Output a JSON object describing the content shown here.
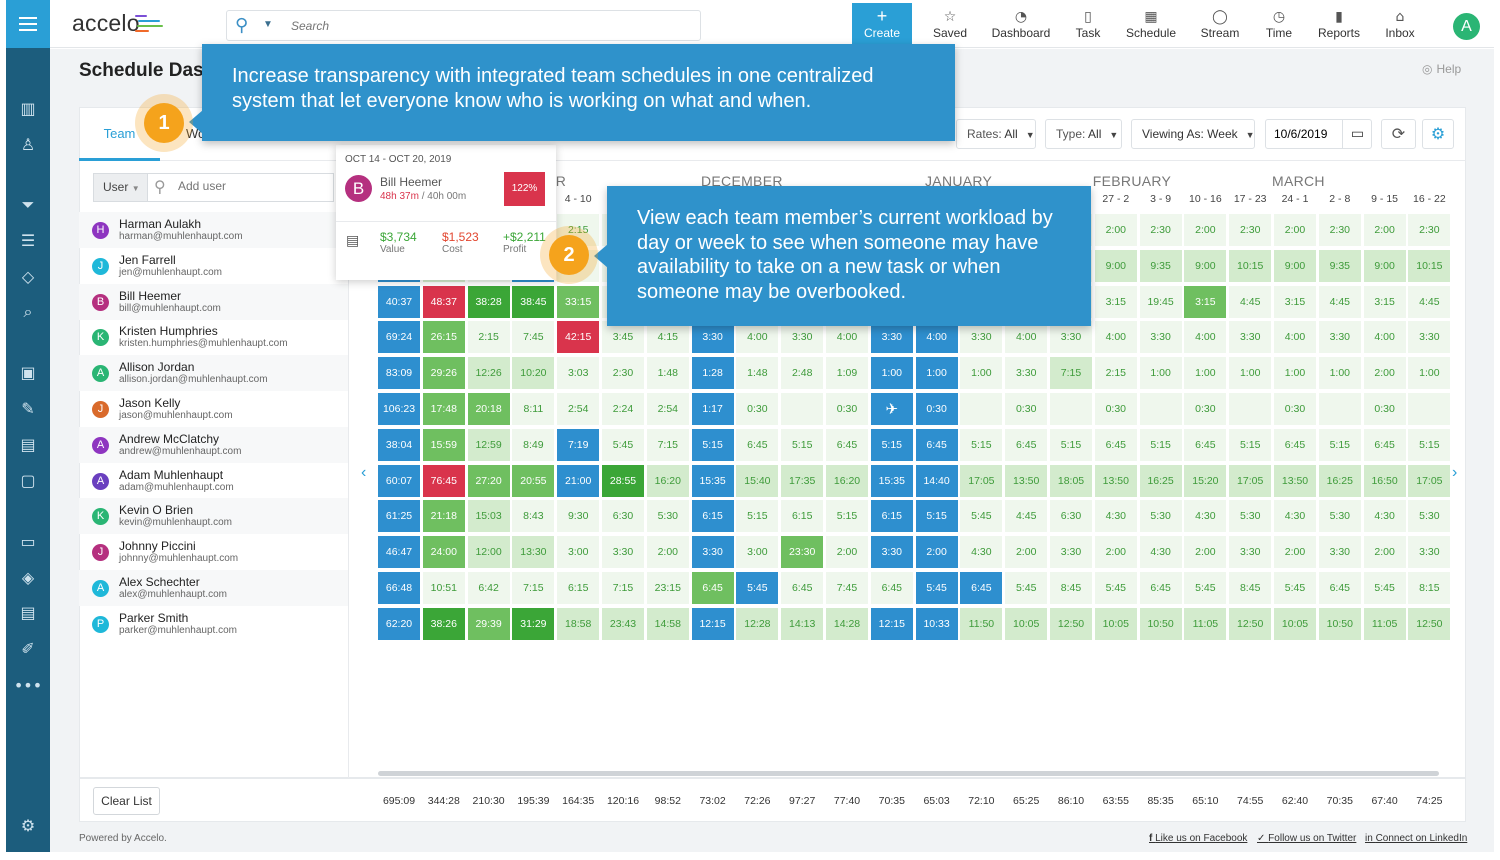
{
  "app": {
    "logo_text": "accelo",
    "title": "Schedule Dashboard",
    "help": "Help"
  },
  "search": {
    "placeholder": "Search"
  },
  "nav": {
    "create": "Create",
    "items": [
      {
        "label": "Saved",
        "icon": "star-icon"
      },
      {
        "label": "Dashboard",
        "icon": "dashboard-icon"
      },
      {
        "label": "Task",
        "icon": "clipboard-icon"
      },
      {
        "label": "Schedule",
        "icon": "calendar-icon"
      },
      {
        "label": "Stream",
        "icon": "chat-icon"
      },
      {
        "label": "Time",
        "icon": "clock-icon"
      },
      {
        "label": "Reports",
        "icon": "bar-chart-icon"
      },
      {
        "label": "Inbox",
        "icon": "inbox-icon"
      }
    ],
    "avatar": "A"
  },
  "sidebar_icons": [
    "building-icon",
    "user-icon",
    "funnel-icon",
    "hierarchy-icon",
    "tag-icon",
    "search-document-icon",
    "ticket-icon",
    "signature-icon",
    "invoice-icon",
    "clipboard-check-icon",
    "inbox-tray-icon",
    "box-icon",
    "document-dollar-icon",
    "edit-icon",
    "more-icon",
    "settings-icon"
  ],
  "tabs": {
    "team": "Team",
    "work": "Wo"
  },
  "toolbar": {
    "rates_label": "Rates:",
    "rates_value": "All",
    "type_label": "Type:",
    "type_value": "All",
    "viewing_label": "Viewing As:",
    "viewing_value": "Week",
    "date": "10/6/2019"
  },
  "user_filter": {
    "dropdown": "User",
    "placeholder": "Add user"
  },
  "colors": {
    "accent": "#2a9fd6",
    "over": "#d9344c",
    "under": "#2e8fcf",
    "booked": "#3ba637",
    "callout": "#2f92cb",
    "badge": "#f5a31c"
  },
  "level_legend": {
    "b": "under-booked (blue)",
    "r": "over-booked (red)",
    "G": "dark green",
    "M": "medium green",
    "L": "light green",
    "p": "pale green"
  },
  "months": [
    {
      "label": "NOVEMBER",
      "col": 2
    },
    {
      "label": "DECEMBER",
      "col": 7
    },
    {
      "label": "JANUARY",
      "col": 12
    },
    {
      "label": "FEBRUARY",
      "col": 16
    },
    {
      "label": "MARCH",
      "col": 20
    }
  ],
  "weeks": [
    "",
    "",
    "",
    "",
    "4 - 10",
    "",
    "",
    "",
    "",
    "",
    "",
    "",
    "",
    "",
    "",
    "",
    "27 - 2",
    "3 - 9",
    "10 - 16",
    "17 - 23",
    "24 - 1",
    "2 - 8",
    "9 - 15",
    "16 - 22"
  ],
  "users": [
    {
      "initial": "H",
      "color": "#8e35c0",
      "name": "Harman Aulakh",
      "email": "harman@muhlenhaupt.com",
      "levels": "pppppppppppppppppppppppp",
      "hours": [
        "",
        "",
        "",
        "",
        "2:15",
        "",
        "",
        "",
        "",
        "",
        "",
        "",
        "",
        "",
        "",
        "",
        "2:00",
        "2:30",
        "2:00",
        "2:30",
        "2:00",
        "2:30",
        "2:00",
        "2:30"
      ]
    },
    {
      "initial": "J",
      "color": "#1fb8d9",
      "name": "Jen Farrell",
      "email": "jen@muhlenhaupt.com",
      "levels": "bLpbppppppppppppLLLLLLLL",
      "hours": [
        "",
        "",
        "",
        "",
        "",
        "",
        "",
        "",
        "",
        "",
        "",
        "",
        "",
        "",
        "",
        "",
        "9:00",
        "9:35",
        "9:00",
        "10:15",
        "9:00",
        "9:35",
        "9:00",
        "10:15"
      ]
    },
    {
      "initial": "B",
      "color": "#b5307f",
      "name": "Bill Heemer",
      "email": "bill@muhlenhaupt.com",
      "levels": "brGGMpppppppppppppMppppppp",
      "hours": [
        "40:37",
        "48:37",
        "38:28",
        "38:45",
        "33:15",
        "",
        "",
        "",
        "",
        "",
        "",
        "",
        "",
        "",
        "",
        "",
        "3:15",
        "19:45",
        "3:15",
        "4:45",
        "3:15",
        "4:45",
        "3:15",
        "4:45"
      ]
    },
    {
      "initial": "K",
      "color": "#2ab574",
      "name": "Kristen Humphries",
      "email": "kristen.humphries@muhlenhaupt.com",
      "levels": "bMpprppbpppbbppppppppppp",
      "hours": [
        "69:24",
        "26:15",
        "2:15",
        "7:45",
        "42:15",
        "3:45",
        "4:15",
        "3:30",
        "4:00",
        "3:30",
        "4:00",
        "3:30",
        "4:00",
        "3:30",
        "4:00",
        "3:30",
        "4:00",
        "3:30",
        "4:00",
        "3:30",
        "4:00",
        "3:30",
        "4:00",
        "3:30"
      ]
    },
    {
      "initial": "A",
      "color": "#2ab574",
      "name": "Allison Jordan",
      "email": "allison.jordan@muhlenhaupt.com",
      "levels": "bMLLpppbpppbbppLpppppppp",
      "hours": [
        "83:09",
        "29:26",
        "12:26",
        "10:20",
        "3:03",
        "2:30",
        "1:48",
        "1:28",
        "1:48",
        "2:48",
        "1:09",
        "1:00",
        "1:00",
        "1:00",
        "3:30",
        "7:15",
        "2:15",
        "1:00",
        "1:00",
        "1:00",
        "1:00",
        "1:00",
        "2:00",
        "1:00"
      ]
    },
    {
      "initial": "J",
      "color": "#d96a2b",
      "name": "Jason Kelly",
      "email": "jason@muhlenhaupt.com",
      "levels": "bMMppppbpppbbppppppppppp",
      "icons": {
        "11": "airplane-icon"
      },
      "hours": [
        "106:23",
        "17:48",
        "20:18",
        "8:11",
        "2:54",
        "2:24",
        "2:54",
        "1:17",
        "0:30",
        "",
        "0:30",
        "",
        "0:30",
        "",
        "0:30",
        "",
        "0:30",
        "",
        "0:30",
        "",
        "0:30",
        "",
        "0:30",
        ""
      ]
    },
    {
      "initial": "A",
      "color": "#8e35c0",
      "name": "Andrew McClatchy",
      "email": "andrew@muhlenhaupt.com",
      "levels": "bMLpbppbpppbbppppppppppp",
      "hours": [
        "38:04",
        "15:59",
        "12:59",
        "8:49",
        "7:19",
        "5:45",
        "7:15",
        "5:15",
        "6:45",
        "5:15",
        "6:45",
        "5:15",
        "6:45",
        "5:15",
        "6:45",
        "5:15",
        "6:45",
        "5:15",
        "6:45",
        "5:15",
        "6:45",
        "5:15",
        "6:45",
        "5:15"
      ]
    },
    {
      "initial": "A",
      "color": "#6a3fbf",
      "name": "Adam Muhlenhaupt",
      "email": "adam@muhlenhaupt.com",
      "levels": "brMMbGLbLLLbbLLLLLLLLLLL",
      "hours": [
        "60:07",
        "76:45",
        "27:20",
        "20:55",
        "21:00",
        "28:55",
        "16:20",
        "15:35",
        "15:40",
        "17:35",
        "16:20",
        "15:35",
        "14:40",
        "17:05",
        "13:50",
        "18:05",
        "13:50",
        "16:25",
        "15:20",
        "17:05",
        "13:50",
        "16:25",
        "16:50",
        "17:05"
      ]
    },
    {
      "initial": "K",
      "color": "#2ab574",
      "name": "Kevin O Brien",
      "email": "kevin@muhlenhaupt.com",
      "levels": "bMLppppbpppbbppppppppppp",
      "hours": [
        "61:25",
        "21:18",
        "15:03",
        "8:43",
        "9:30",
        "6:30",
        "5:30",
        "6:15",
        "5:15",
        "6:15",
        "5:15",
        "6:15",
        "5:15",
        "5:45",
        "4:45",
        "6:30",
        "4:30",
        "5:30",
        "4:30",
        "5:30",
        "4:30",
        "5:30",
        "4:30",
        "5:30"
      ]
    },
    {
      "initial": "J",
      "color": "#b5307f",
      "name": "Johnny Piccini",
      "email": "johnny@muhlenhaupt.com",
      "levels": "bMLLpppbpMpbbppppppppppp",
      "hours": [
        "46:47",
        "24:00",
        "12:00",
        "13:30",
        "3:00",
        "3:30",
        "2:00",
        "3:30",
        "3:00",
        "23:30",
        "2:00",
        "3:30",
        "2:00",
        "4:30",
        "2:00",
        "3:30",
        "2:00",
        "4:30",
        "2:00",
        "3:30",
        "2:00",
        "3:30",
        "2:00",
        "3:30"
      ]
    },
    {
      "initial": "A",
      "color": "#1fb8d9",
      "name": "Alex Schechter",
      "email": "alex@muhlenhaupt.com",
      "levels": "bppppppMbpppbbpppppppppp",
      "hours": [
        "66:48",
        "10:51",
        "6:42",
        "7:15",
        "6:15",
        "7:15",
        "23:15",
        "6:45",
        "5:45",
        "6:45",
        "7:45",
        "6:45",
        "5:45",
        "6:45",
        "5:45",
        "8:45",
        "5:45",
        "6:45",
        "5:45",
        "8:45",
        "5:45",
        "6:45",
        "5:45",
        "8:15"
      ]
    },
    {
      "initial": "P",
      "color": "#1fb8d9",
      "name": "Parker Smith",
      "email": "parker@muhlenhaupt.com",
      "levels": "bGMGLLLbLLLbbLLLLLLLLLLL",
      "hours": [
        "62:20",
        "38:26",
        "29:39",
        "31:29",
        "18:58",
        "23:43",
        "14:58",
        "12:15",
        "12:28",
        "14:13",
        "14:28",
        "12:15",
        "10:33",
        "11:50",
        "10:05",
        "12:50",
        "10:05",
        "10:50",
        "11:05",
        "12:50",
        "10:05",
        "10:50",
        "11:05",
        "12:50"
      ]
    }
  ],
  "totals": [
    "695:09",
    "344:28",
    "210:30",
    "195:39",
    "164:35",
    "120:16",
    "98:52",
    "73:02",
    "72:26",
    "97:27",
    "77:40",
    "70:35",
    "65:03",
    "72:10",
    "65:25",
    "86:10",
    "63:55",
    "85:35",
    "65:10",
    "74:55",
    "62:40",
    "70:35",
    "67:40",
    "74:25"
  ],
  "clear_list": "Clear List",
  "popup": {
    "range": "OCT 14 - OCT 20, 2019",
    "initial": "B",
    "name": "Bill Heemer",
    "booked": "48h 37m",
    "capacity": " / 40h 00m",
    "percent": "122%",
    "value": "$3,734",
    "value_label": "Value",
    "cost": "$1,523",
    "cost_label": "Cost",
    "profit": "+$2,211",
    "profit_label": "Profit"
  },
  "callouts": [
    {
      "badge": "1",
      "text": "Increase transparency with integrated team schedules in one centralized system that let everyone know who is working on what and when."
    },
    {
      "badge": "2",
      "text": "View each team member’s current workload by day or week to see when someone may have availability to take on a new task or when someone may be overbooked."
    }
  ],
  "footer": {
    "powered": "Powered by Accelo.",
    "links": [
      "Like us on Facebook",
      "Follow us on Twitter",
      "Connect on LinkedIn"
    ]
  }
}
